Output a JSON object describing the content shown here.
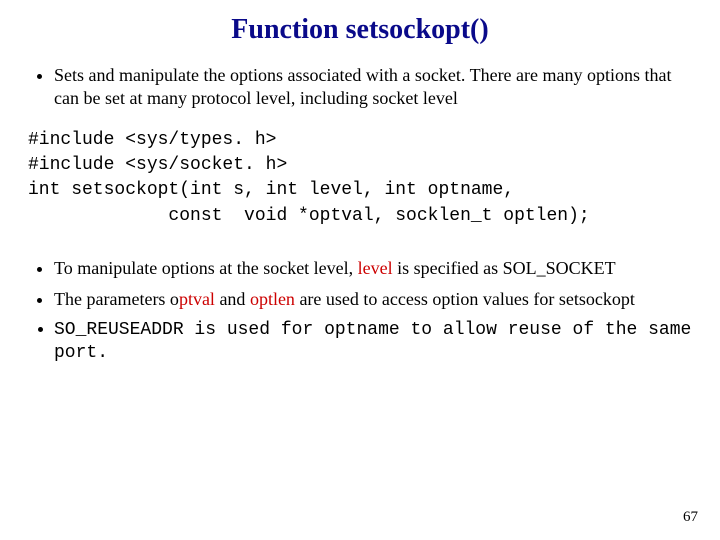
{
  "title": "Function setsockopt()",
  "b1": "Sets and manipulate the options associated with a socket. There are many options that can be set at many protocol level, including socket level",
  "code": "#include <sys/types. h>\n#include <sys/socket. h>\nint setsockopt(int s, int level, int optname,\n             const  void *optval, socklen_t optlen);",
  "b2": {
    "pre": " To manipulate options at the socket level, ",
    "kw": "level",
    "post": " is specified  as SOL_SOCKET"
  },
  "b3": {
    "a": " The parameters o",
    "kw1": "ptval",
    "b": " and ",
    "kw2": "optlen",
    "c": " are used to access option values  for setsockopt"
  },
  "b4": {
    "a": "SO_REUSEADDR",
    "b": " is used for ",
    "c": "optname",
    "d": " to allow reuse of the same port."
  },
  "page": "67"
}
